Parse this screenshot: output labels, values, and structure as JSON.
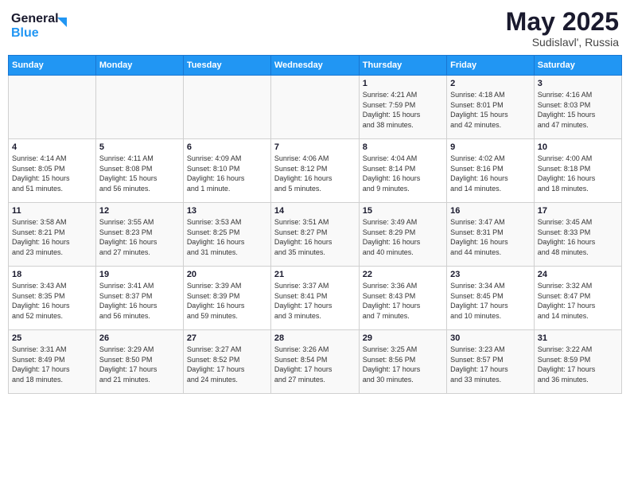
{
  "header": {
    "logo_general": "General",
    "logo_blue": "Blue",
    "title": "May 2025",
    "location": "Sudislavl', Russia"
  },
  "weekdays": [
    "Sunday",
    "Monday",
    "Tuesday",
    "Wednesday",
    "Thursday",
    "Friday",
    "Saturday"
  ],
  "weeks": [
    [
      {
        "day": "",
        "info": ""
      },
      {
        "day": "",
        "info": ""
      },
      {
        "day": "",
        "info": ""
      },
      {
        "day": "",
        "info": ""
      },
      {
        "day": "1",
        "info": "Sunrise: 4:21 AM\nSunset: 7:59 PM\nDaylight: 15 hours\nand 38 minutes."
      },
      {
        "day": "2",
        "info": "Sunrise: 4:18 AM\nSunset: 8:01 PM\nDaylight: 15 hours\nand 42 minutes."
      },
      {
        "day": "3",
        "info": "Sunrise: 4:16 AM\nSunset: 8:03 PM\nDaylight: 15 hours\nand 47 minutes."
      }
    ],
    [
      {
        "day": "4",
        "info": "Sunrise: 4:14 AM\nSunset: 8:05 PM\nDaylight: 15 hours\nand 51 minutes."
      },
      {
        "day": "5",
        "info": "Sunrise: 4:11 AM\nSunset: 8:08 PM\nDaylight: 15 hours\nand 56 minutes."
      },
      {
        "day": "6",
        "info": "Sunrise: 4:09 AM\nSunset: 8:10 PM\nDaylight: 16 hours\nand 1 minute."
      },
      {
        "day": "7",
        "info": "Sunrise: 4:06 AM\nSunset: 8:12 PM\nDaylight: 16 hours\nand 5 minutes."
      },
      {
        "day": "8",
        "info": "Sunrise: 4:04 AM\nSunset: 8:14 PM\nDaylight: 16 hours\nand 9 minutes."
      },
      {
        "day": "9",
        "info": "Sunrise: 4:02 AM\nSunset: 8:16 PM\nDaylight: 16 hours\nand 14 minutes."
      },
      {
        "day": "10",
        "info": "Sunrise: 4:00 AM\nSunset: 8:18 PM\nDaylight: 16 hours\nand 18 minutes."
      }
    ],
    [
      {
        "day": "11",
        "info": "Sunrise: 3:58 AM\nSunset: 8:21 PM\nDaylight: 16 hours\nand 23 minutes."
      },
      {
        "day": "12",
        "info": "Sunrise: 3:55 AM\nSunset: 8:23 PM\nDaylight: 16 hours\nand 27 minutes."
      },
      {
        "day": "13",
        "info": "Sunrise: 3:53 AM\nSunset: 8:25 PM\nDaylight: 16 hours\nand 31 minutes."
      },
      {
        "day": "14",
        "info": "Sunrise: 3:51 AM\nSunset: 8:27 PM\nDaylight: 16 hours\nand 35 minutes."
      },
      {
        "day": "15",
        "info": "Sunrise: 3:49 AM\nSunset: 8:29 PM\nDaylight: 16 hours\nand 40 minutes."
      },
      {
        "day": "16",
        "info": "Sunrise: 3:47 AM\nSunset: 8:31 PM\nDaylight: 16 hours\nand 44 minutes."
      },
      {
        "day": "17",
        "info": "Sunrise: 3:45 AM\nSunset: 8:33 PM\nDaylight: 16 hours\nand 48 minutes."
      }
    ],
    [
      {
        "day": "18",
        "info": "Sunrise: 3:43 AM\nSunset: 8:35 PM\nDaylight: 16 hours\nand 52 minutes."
      },
      {
        "day": "19",
        "info": "Sunrise: 3:41 AM\nSunset: 8:37 PM\nDaylight: 16 hours\nand 56 minutes."
      },
      {
        "day": "20",
        "info": "Sunrise: 3:39 AM\nSunset: 8:39 PM\nDaylight: 16 hours\nand 59 minutes."
      },
      {
        "day": "21",
        "info": "Sunrise: 3:37 AM\nSunset: 8:41 PM\nDaylight: 17 hours\nand 3 minutes."
      },
      {
        "day": "22",
        "info": "Sunrise: 3:36 AM\nSunset: 8:43 PM\nDaylight: 17 hours\nand 7 minutes."
      },
      {
        "day": "23",
        "info": "Sunrise: 3:34 AM\nSunset: 8:45 PM\nDaylight: 17 hours\nand 10 minutes."
      },
      {
        "day": "24",
        "info": "Sunrise: 3:32 AM\nSunset: 8:47 PM\nDaylight: 17 hours\nand 14 minutes."
      }
    ],
    [
      {
        "day": "25",
        "info": "Sunrise: 3:31 AM\nSunset: 8:49 PM\nDaylight: 17 hours\nand 18 minutes."
      },
      {
        "day": "26",
        "info": "Sunrise: 3:29 AM\nSunset: 8:50 PM\nDaylight: 17 hours\nand 21 minutes."
      },
      {
        "day": "27",
        "info": "Sunrise: 3:27 AM\nSunset: 8:52 PM\nDaylight: 17 hours\nand 24 minutes."
      },
      {
        "day": "28",
        "info": "Sunrise: 3:26 AM\nSunset: 8:54 PM\nDaylight: 17 hours\nand 27 minutes."
      },
      {
        "day": "29",
        "info": "Sunrise: 3:25 AM\nSunset: 8:56 PM\nDaylight: 17 hours\nand 30 minutes."
      },
      {
        "day": "30",
        "info": "Sunrise: 3:23 AM\nSunset: 8:57 PM\nDaylight: 17 hours\nand 33 minutes."
      },
      {
        "day": "31",
        "info": "Sunrise: 3:22 AM\nSunset: 8:59 PM\nDaylight: 17 hours\nand 36 minutes."
      }
    ]
  ]
}
